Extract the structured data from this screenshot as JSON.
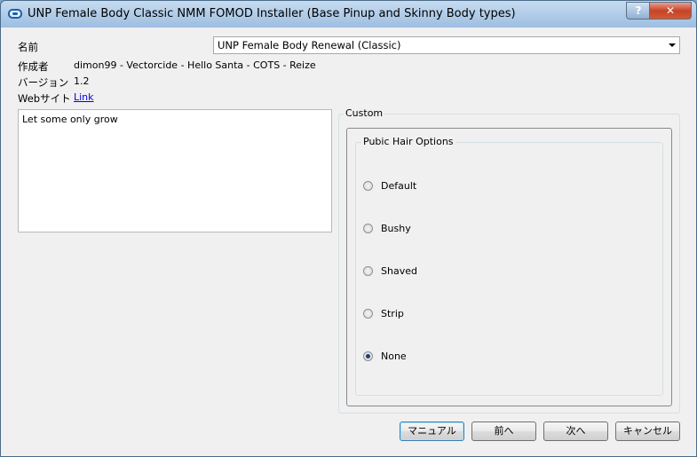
{
  "window": {
    "title": "UNP Female Body Classic NMM FOMOD Installer (Base Pinup and Skinny Body types)",
    "help_label": "?",
    "close_label": "✕"
  },
  "info": {
    "name_label": "名前",
    "name_value": "UNP Female Body Renewal (Classic)",
    "author_label": "作成者",
    "author_value": "dimon99 - Vectorcide - Hello Santa - COTS - Reize",
    "version_label": "バージョン",
    "version_value": "1.2",
    "website_label": "Webサイト",
    "website_value": "Link"
  },
  "description": "Let some only grow",
  "custom": {
    "group_title": "Custom",
    "subgroup_title": "Pubic Hair Options",
    "options": [
      {
        "label": "Default",
        "checked": false
      },
      {
        "label": "Bushy",
        "checked": false
      },
      {
        "label": "Shaved",
        "checked": false
      },
      {
        "label": "Strip",
        "checked": false
      },
      {
        "label": "None",
        "checked": true
      }
    ]
  },
  "buttons": {
    "manual": "マニュアル",
    "back": "前へ",
    "next": "次へ",
    "cancel": "キャンセル"
  }
}
